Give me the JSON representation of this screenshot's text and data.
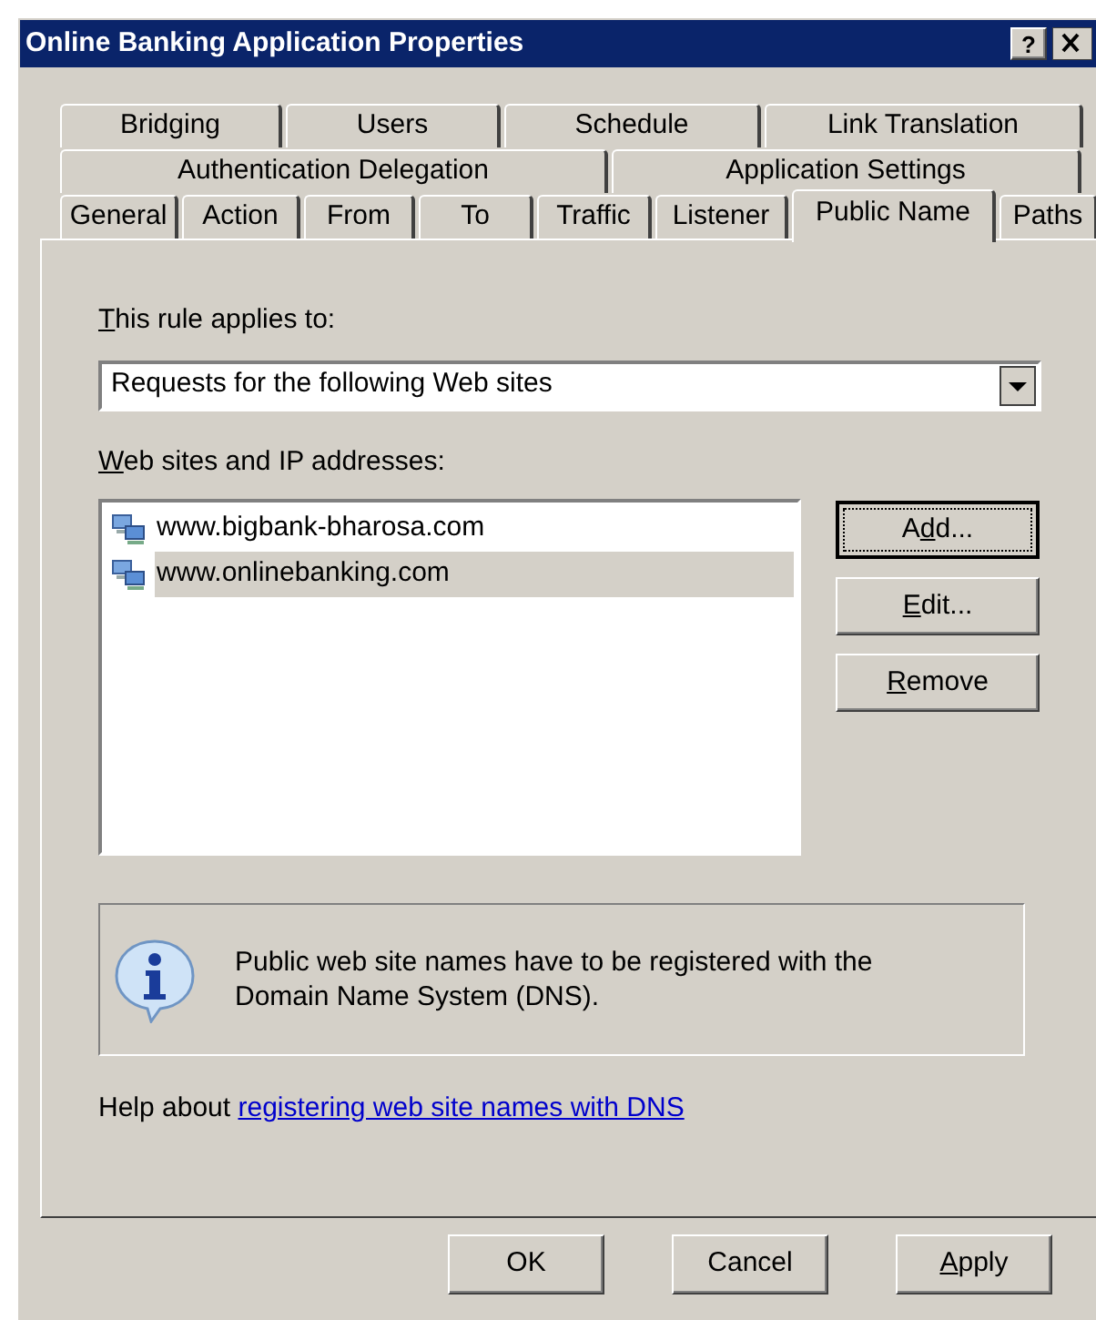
{
  "window": {
    "title": "Online Banking Application Properties",
    "help_button": "?"
  },
  "tab_rows": [
    {
      "tabs": [
        {
          "label": "Bridging",
          "selected": false
        },
        {
          "label": "Users",
          "selected": false
        },
        {
          "label": "Schedule",
          "selected": false
        },
        {
          "label": "Link Translation",
          "selected": false
        }
      ]
    },
    {
      "tabs": [
        {
          "label": "Authentication Delegation",
          "selected": false
        },
        {
          "label": "Application Settings",
          "selected": false
        }
      ]
    },
    {
      "tabs": [
        {
          "label": "General",
          "selected": false
        },
        {
          "label": "Action",
          "selected": false
        },
        {
          "label": "From",
          "selected": false
        },
        {
          "label": "To",
          "selected": false
        },
        {
          "label": "Traffic",
          "selected": false
        },
        {
          "label": "Listener",
          "selected": false
        },
        {
          "label": "Public Name",
          "selected": true
        },
        {
          "label": "Paths",
          "selected": false
        }
      ]
    }
  ],
  "applies_label": {
    "key": "T",
    "after": "his rule applies to:"
  },
  "applies_dropdown": {
    "value": "Requests for the following Web sites"
  },
  "sites_label": {
    "key": "W",
    "after": "eb sites and IP addresses:"
  },
  "sites": [
    {
      "label": "www.bigbank-bharosa.com",
      "selected": false
    },
    {
      "label": "www.onlinebanking.com",
      "selected": true
    }
  ],
  "side_buttons": [
    {
      "before": "A",
      "key": "d",
      "after": "d...",
      "default": true
    },
    {
      "key": "E",
      "after": "dit...",
      "default": false
    },
    {
      "key": "R",
      "after": "emove",
      "default": false
    }
  ],
  "info": {
    "text": "Public web site names have to be registered with the Domain Name System (DNS)."
  },
  "help": {
    "text": "Help about",
    "link": "registering web site names with DNS"
  },
  "buttons": [
    {
      "before": "OK"
    },
    {
      "before": "Cancel"
    },
    {
      "key": "A",
      "after": "pply"
    }
  ]
}
